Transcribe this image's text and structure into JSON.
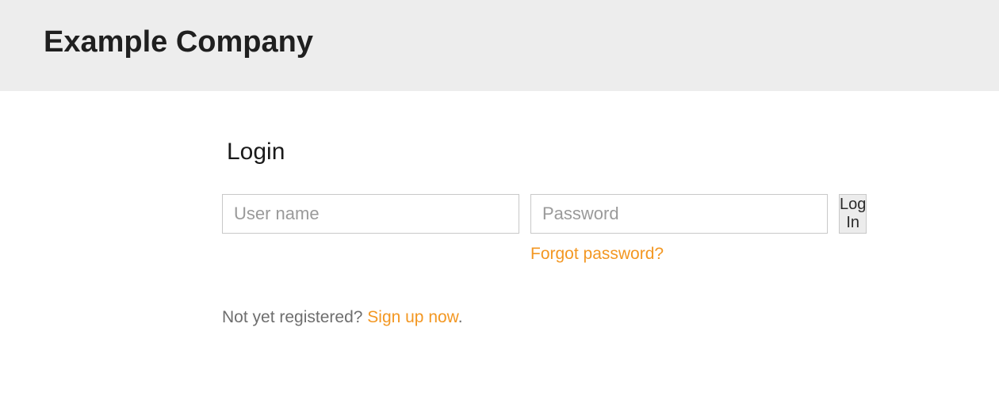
{
  "header": {
    "company_name": "Example Company"
  },
  "login": {
    "title": "Login",
    "username_placeholder": "User name",
    "username_value": "",
    "password_placeholder": "Password",
    "password_value": "",
    "button_label": "Log In",
    "forgot_password_label": "Forgot password?"
  },
  "signup": {
    "prompt": "Not yet registered? ",
    "link_label": "Sign up now",
    "period": "."
  },
  "colors": {
    "accent": "#f39722",
    "header_bg": "#ededed",
    "border": "#c8c8c8",
    "text_dark": "#1f1f1f",
    "text_muted": "#6e6e6e"
  }
}
